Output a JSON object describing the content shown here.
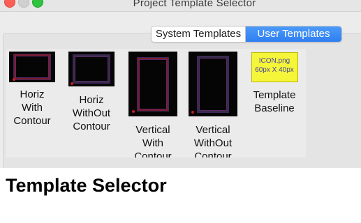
{
  "window": {
    "title": "Project Template Selector"
  },
  "tabs": [
    {
      "label": "System Templates",
      "selected": false
    },
    {
      "label": "User Templates",
      "selected": true
    }
  ],
  "templates": [
    {
      "line1": "Horiz",
      "line2": "With",
      "line3": "Contour",
      "thumbnail": "horizontal-with-contour"
    },
    {
      "line1": "Horiz",
      "line2": "WithOut",
      "line3": "Contour",
      "thumbnail": "horizontal-without-contour"
    },
    {
      "line1": "Vertical",
      "line2": "With",
      "line3": "Contour",
      "thumbnail": "vertical-with-contour"
    },
    {
      "line1": "Vertical",
      "line2": "WithOut",
      "line3": "Contour",
      "thumbnail": "vertical-without-contour"
    },
    {
      "line1": "Template",
      "line2": "Baseline",
      "line3": "",
      "thumbnail": "icon-placeholder",
      "icon_text_1": "ICON.png",
      "icon_text_2": "60px X 40px"
    }
  ],
  "page": {
    "heading": "Template Selector"
  },
  "colors": {
    "accent": "#3b87f5",
    "thumb_bg": "#050505",
    "icon_bg": "#f5f53a"
  }
}
